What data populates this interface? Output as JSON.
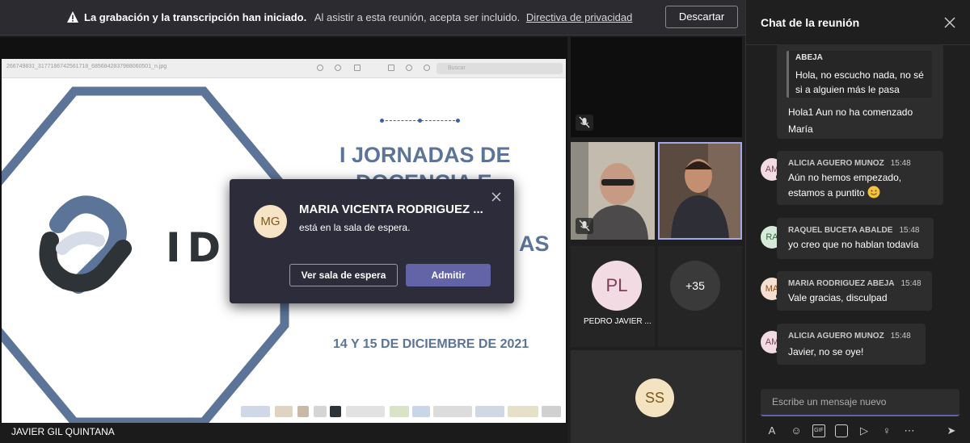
{
  "banner": {
    "title": "La grabación y la transcripción han iniciado.",
    "subtitle": "Al asistir a esta reunión, acepta ser incluido.",
    "link": "Directiva de privacidad",
    "dismiss_label": "Descartar"
  },
  "share": {
    "viewer_filename": "266749831_3177186742561718_6856842837988060501_n.jpg",
    "viewer_search_placeholder": "Buscar",
    "logo_text": "ID",
    "title_line1": "I JORNADAS DE",
    "title_line2": "DOCENCIA E",
    "title_fragment": "AS",
    "dates": "14 Y 15 DE DICIEMBRE DE 2021",
    "presenter": "JAVIER GIL QUINTANA"
  },
  "participants": {
    "pl_initials": "PL",
    "pl_name": "PEDRO JAVIER ...",
    "more_count": "+35",
    "ss_initials": "SS"
  },
  "lobby": {
    "initials": "MG",
    "name": "MARIA VICENTA RODRIGUEZ ...",
    "status": "está en la sala de espera.",
    "view_lobby_label": "Ver sala de espera",
    "admit_label": "Admitir"
  },
  "chat": {
    "title": "Chat de la reunión",
    "quoted": {
      "author": "ABEJA",
      "text": "Hola, no escucho nada, no sé si a alguien más le pasa"
    },
    "first_message_text": "Hola1 Aun no ha comenzado María",
    "messages": [
      {
        "initials": "AM",
        "author": "ALICIA AGUERO MUNOZ",
        "time": "15:48",
        "text": "Aún no hemos empezado, estamos a puntito",
        "avatar_bg": "#f2dbe3",
        "avatar_fg": "#7d3f58"
      },
      {
        "initials": "RA",
        "author": "RAQUEL BUCETA ABALDE",
        "time": "15:48",
        "text": "yo creo que no hablan todavía",
        "avatar_bg": "#d7ead9",
        "avatar_fg": "#2f6b3a"
      },
      {
        "initials": "MA",
        "author": "MARIA RODRIGUEZ ABEJA",
        "time": "15:48",
        "text": "Vale gracias, disculpad",
        "avatar_bg": "#f5dfd0",
        "avatar_fg": "#8a4a22"
      },
      {
        "initials": "AM",
        "author": "ALICIA AGUERO MUNOZ",
        "time": "15:48",
        "text": "Javier, no se oye!",
        "avatar_bg": "#f2dbe3",
        "avatar_fg": "#7d3f58"
      }
    ],
    "composer_placeholder": "Escribe un mensaje nuevo",
    "toolbar_icons": [
      "format-icon",
      "emoji-icon",
      "gif-icon",
      "sticker-icon",
      "meet-now-icon",
      "praise-icon",
      "more-options-icon",
      "send-icon"
    ]
  },
  "colors": {
    "accent": "#6264a7",
    "presence_busy": "#c4314b",
    "slide_blue": "#5c7497"
  }
}
